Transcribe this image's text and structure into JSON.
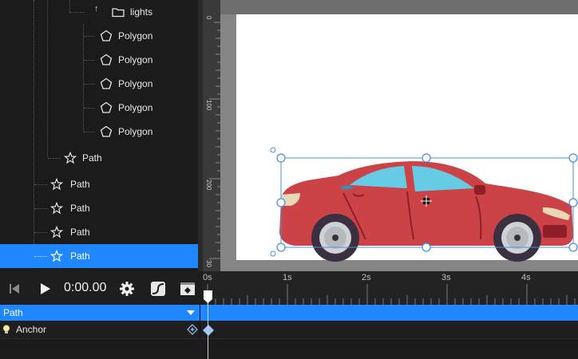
{
  "layers": {
    "folder_label": "lights",
    "polygons": [
      "Polygon",
      "Polygon",
      "Polygon",
      "Polygon",
      "Polygon"
    ],
    "paths": [
      "Path",
      "Path",
      "Path",
      "Path",
      "Path"
    ]
  },
  "rulers": {
    "vertical": [
      "0",
      "100",
      "200",
      "30"
    ]
  },
  "transport": {
    "time": "0:00.00"
  },
  "timeline": {
    "ticks": [
      "0s",
      "1s",
      "2s",
      "3s",
      "4s"
    ]
  },
  "tracks": {
    "path_label": "Path",
    "anchor_label": "Anchor"
  },
  "colors": {
    "selection": "#1f87ff",
    "car_body": "#cc4347",
    "window": "#66cbe5",
    "tire": "#3b3040",
    "rim": "#cfd2d6"
  }
}
